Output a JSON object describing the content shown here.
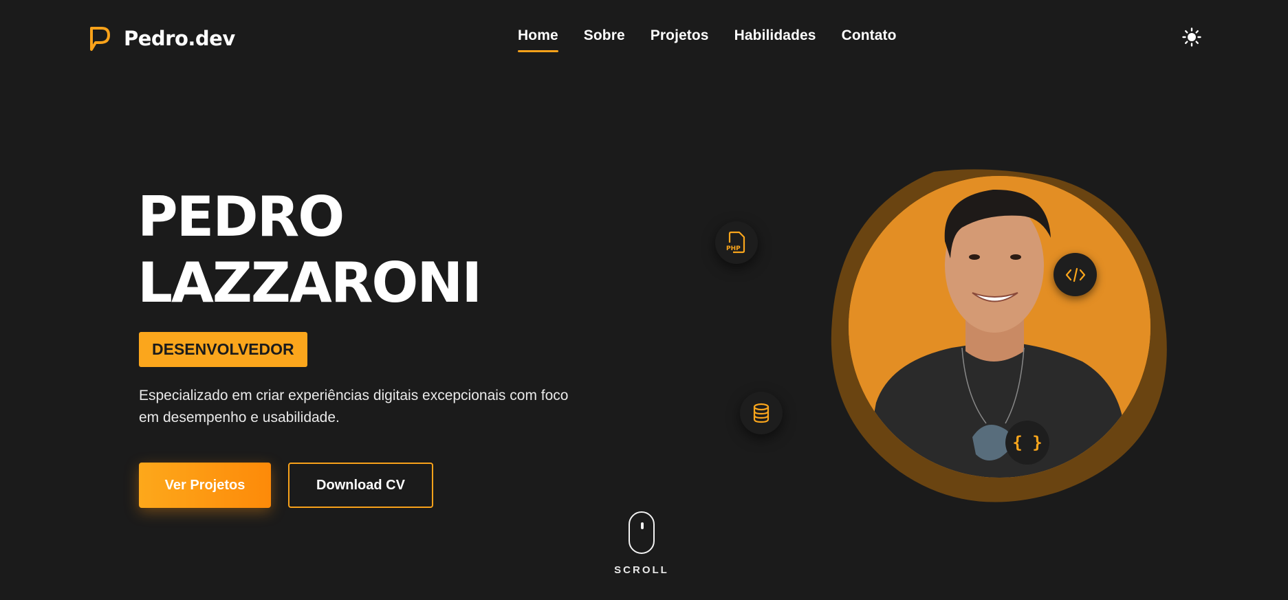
{
  "header": {
    "logo_text": "Pedro.dev",
    "nav": [
      {
        "label": "Home",
        "active": true
      },
      {
        "label": "Sobre",
        "active": false
      },
      {
        "label": "Projetos",
        "active": false
      },
      {
        "label": "Habilidades",
        "active": false
      },
      {
        "label": "Contato",
        "active": false
      }
    ],
    "theme_icon": "sun-icon"
  },
  "hero": {
    "name_line1": "PEDRO",
    "name_line2": "LAZZARONI",
    "role": "DESENVOLVEDOR",
    "description": "Especializado em criar experiências digitais excepcionais com foco em desempenho e usabilidade.",
    "primary_button": "Ver Projetos",
    "secondary_button": "Download CV"
  },
  "floating_icons": {
    "php_label": "PHP",
    "database_icon": "database-icon",
    "code_icon": "code-icon",
    "braces_label": "{ }"
  },
  "scroll": {
    "label": "SCROLL"
  },
  "colors": {
    "background": "#1b1b1b",
    "accent": "#fba61c",
    "accent_dark": "#fd8a09",
    "portrait_bg": "#e38e24",
    "blob": "#6a4411"
  }
}
